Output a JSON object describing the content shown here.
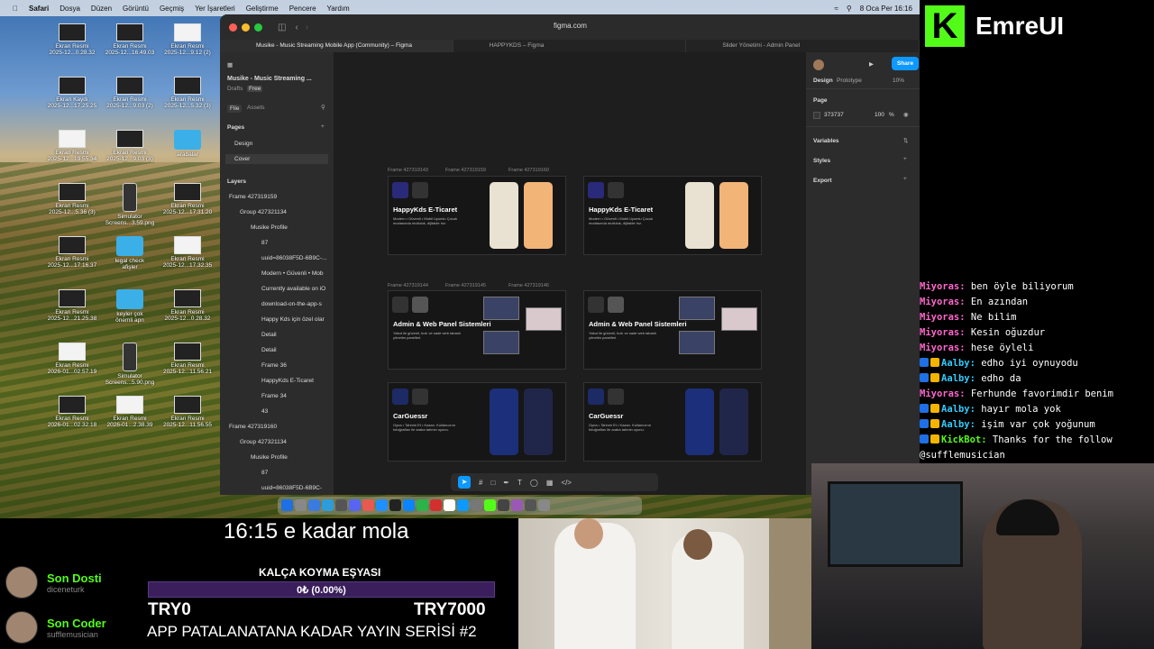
{
  "menubar": {
    "app": "Safari",
    "items": [
      "Dosya",
      "Düzen",
      "Görüntü",
      "Geçmiş",
      "Yer İşaretleri",
      "Geliştirme",
      "Pencere",
      "Yardım"
    ],
    "datetime": "8 Oca Per 16:16"
  },
  "desktop_icons": [
    {
      "label": "Ekran Resmi\n2025-12...0.28.32"
    },
    {
      "label": "Ekran Resmi\n2025-12...16.49.03"
    },
    {
      "label": "Ekran Resmi\n2025-12...9.12 (2)"
    },
    {
      "label": "Ekran Kaydı\n2025-12...17.25.25"
    },
    {
      "label": "Ekran Resmi\n2025-12...9.03 (2)"
    },
    {
      "label": "Ekran Resmi\n2025-12...5.32 (3)"
    },
    {
      "label": "Ekran Resmi\n2025-12...19.55.34"
    },
    {
      "label": "Ekran Resmi\n2025-12...9.03 (3)"
    },
    {
      "label": "arabalar"
    },
    {
      "label": "Ekran Resmi\n2025-12...5.36 (3)"
    },
    {
      "label": "Simulator\nScreens...3.59.png"
    },
    {
      "label": "Ekran Resmi\n2025-12...17.31.20"
    },
    {
      "label": "Ekran Resmi\n2025-12...17.16.37"
    },
    {
      "label": "legal check\nafişler"
    },
    {
      "label": "Ekran Resmi\n2025-12...17.32.35"
    },
    {
      "label": "Ekran Resmi\n2025-12...21.25.38"
    },
    {
      "label": "keyler çok\nönemli apn"
    },
    {
      "label": "Ekran Resmi\n2025-12...0.28.32"
    },
    {
      "label": "Ekran Resmi\n2026-01...02.57.19"
    },
    {
      "label": "Simulator\nScreens...5.90.png"
    },
    {
      "label": "Ekran Resmi\n2025-12...11.56.21"
    },
    {
      "label": "Ekran Resmi\n2026-01...02.32.18"
    },
    {
      "label": "Ekran Resmi\n2026-01...2.38.39"
    },
    {
      "label": "Ekran Resmi\n2025-12...11.56.55"
    }
  ],
  "browser": {
    "url": "figma.com",
    "tabs": [
      "Musike - Music Streaming Mobile App (Community) – Figma",
      "HAPPYKDS – Figma",
      "Slider Yönetimi - Admin Panel"
    ]
  },
  "figma": {
    "file_name": "Musike - Music Streaming ...",
    "drafts": "Drafts",
    "free_badge": "Free",
    "tab_file": "File",
    "tab_assets": "Assets",
    "pages_header": "Pages",
    "pages": [
      "Design",
      "Cover"
    ],
    "layers_header": "Layers",
    "layers": [
      "Frame 427319159",
      "Group 427321134",
      "Musike Profile",
      "87",
      "uuid=86038F5D-6B9C-...",
      "Modern • Güvenli • Mob",
      "Currently available on iO",
      "download-on-the-app-s",
      "Happy Kds için özel olar",
      "Detail",
      "Detail",
      "Frame 36",
      "HappyKds E-Ticaret",
      "Frame 34",
      "43",
      "Frame 427319160",
      "Group 427321134",
      "Musike Profile",
      "87",
      "uuid=86038F5D-6B9C-"
    ],
    "frame_labels": [
      "Frame 427319143",
      "Frame 427319159",
      "Frame 427319160",
      "Frame 427319144",
      "Frame 427319145",
      "Frame 427319146"
    ],
    "cards": [
      {
        "title": "HappyKds E-Ticaret",
        "sub": "Modern • Güvenli • Mobil Uyumlu Çocuk modasında mutluluk, dijitalde hız."
      },
      {
        "title": "HappyKds E-Ticaret",
        "sub": "Modern • Güvenli • Mobil Uyumlu Çocuk modasında mutluluk, dijitalde hız."
      },
      {
        "title": "Admin & Web Panel Sistemleri",
        "sub": "Yakut ile güvenli, hızlı ve sade web tabanlı yönetim panelleri."
      },
      {
        "title": "Admin & Web Panel Sistemleri",
        "sub": "Yakut ile güvenli, hızlı ve sade web tabanlı yönetim panelleri."
      },
      {
        "title": "CarGuessr",
        "sub": "Oyna • Tahmin Et • Kazan. Kullanıcının fotoğrafları ile araba tahmin oyunu."
      },
      {
        "title": "CarGuessr",
        "sub": "Oyna • Tahmin Et • Kazan. Kullanıcının fotoğrafları ile araba tahmin oyunu."
      }
    ],
    "right": {
      "share": "Share",
      "design_tab": "Design",
      "prototype_tab": "Prototype",
      "zoom": "10%",
      "page_header": "Page",
      "page_color": "373737",
      "page_opacity": "100",
      "percent": "%",
      "variables": "Variables",
      "styles": "Styles",
      "export": "Export"
    }
  },
  "brand": {
    "logo_letter": "K",
    "name": "EmreUI"
  },
  "chat": [
    {
      "user": "Miyoras:",
      "msg": "ben öyle biliyorum",
      "color": "#ff66cc",
      "badges": 0
    },
    {
      "user": "Miyoras:",
      "msg": "En azından",
      "color": "#ff66cc",
      "badges": 0
    },
    {
      "user": "Miyoras:",
      "msg": "Ne bilim",
      "color": "#ff66cc",
      "badges": 0
    },
    {
      "user": "Miyoras:",
      "msg": "Kesin oğuzdur",
      "color": "#ff66cc",
      "badges": 0
    },
    {
      "user": "Miyoras:",
      "msg": "hese öyleli",
      "color": "#ff66cc",
      "badges": 0
    },
    {
      "user": "Aalby:",
      "msg": "edho iyi oynuyodu",
      "color": "#33ccff",
      "badges": 2
    },
    {
      "user": "Aalby:",
      "msg": "edho da",
      "color": "#33ccff",
      "badges": 2
    },
    {
      "user": "Miyoras:",
      "msg": "Ferhunde favorimdir benim",
      "color": "#ff66cc",
      "badges": 0
    },
    {
      "user": "Aalby:",
      "msg": "hayır mola yok",
      "color": "#33ccff",
      "badges": 2
    },
    {
      "user": "Aalby:",
      "msg": "işim var çok yoğunum",
      "color": "#33ccff",
      "badges": 2
    },
    {
      "user": "KickBot:",
      "msg": "Thanks for the follow",
      "color": "#53fc18",
      "badges": 2
    },
    {
      "user": "",
      "msg": "@sufflemusician",
      "color": "#ffffff",
      "badges": 0
    }
  ],
  "overlay": {
    "mola": "16:15 e kadar mola",
    "goal_title": "KALÇA KOYMA EŞYASI",
    "goal_progress": "0₺ (0.00%)",
    "goal_fraction": 0.0,
    "goal_min": "TRY0",
    "goal_max": "TRY7000",
    "series": "APP PATALANATANA KADAR YAYIN SERİSİ #2"
  },
  "supporters": [
    {
      "role": "Son Dosti",
      "name": "diceneturk"
    },
    {
      "role": "Son Coder",
      "name": "sufflemusician"
    }
  ],
  "colors": {
    "kick_green": "#53fc18",
    "figma_blue": "#0d99ff",
    "goal_purple": "#8a5cd4"
  }
}
